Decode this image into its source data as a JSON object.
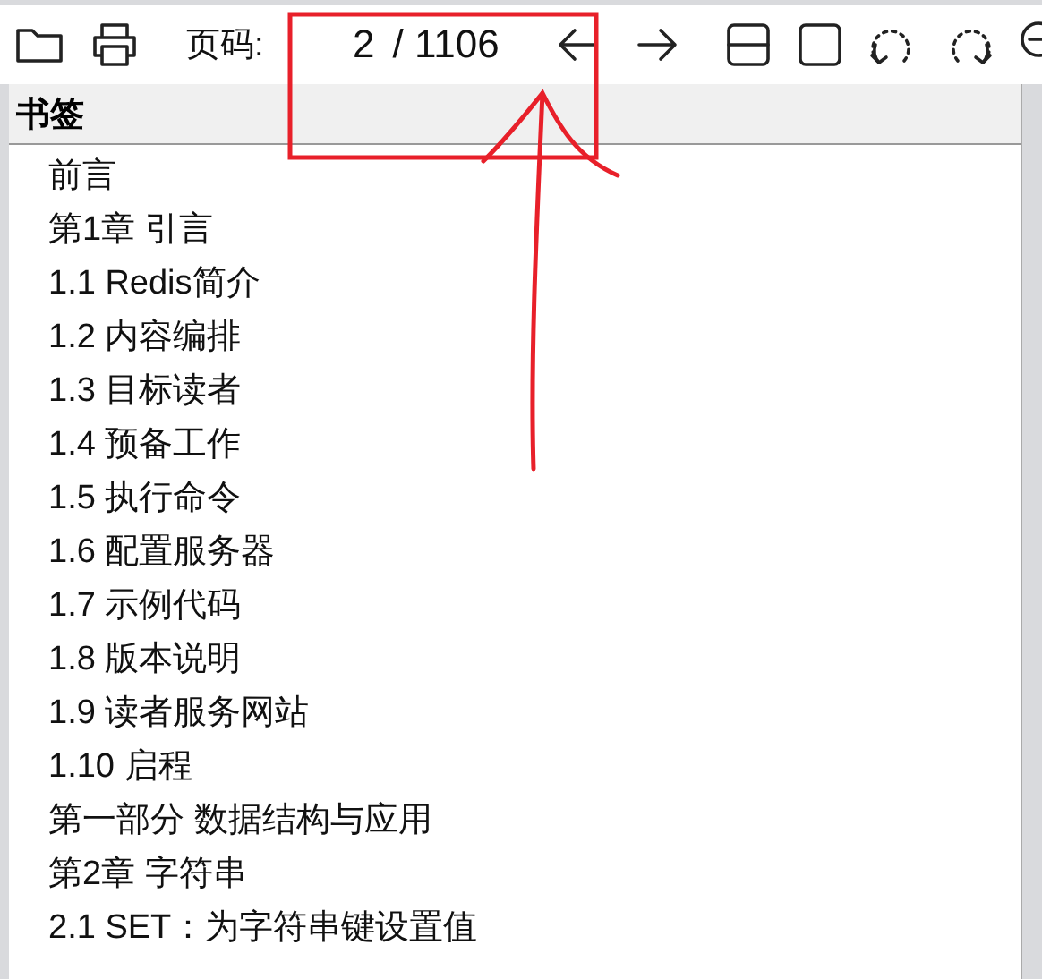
{
  "toolbar": {
    "page_label": "页码:",
    "page_value": "2",
    "page_total": "/ 1106"
  },
  "bookmarks": {
    "title": "书签",
    "items": [
      "前言",
      "第1章 引言",
      "1.1 Redis简介",
      "1.2 内容编排",
      "1.3 目标读者",
      "1.4 预备工作",
      "1.5 执行命令",
      "1.6 配置服务器",
      "1.7 示例代码",
      "1.8 版本说明",
      "1.9 读者服务网站",
      "1.10 启程",
      "第一部分 数据结构与应用",
      "第2章 字符串",
      "2.1 SET：为字符串键设置值"
    ]
  }
}
